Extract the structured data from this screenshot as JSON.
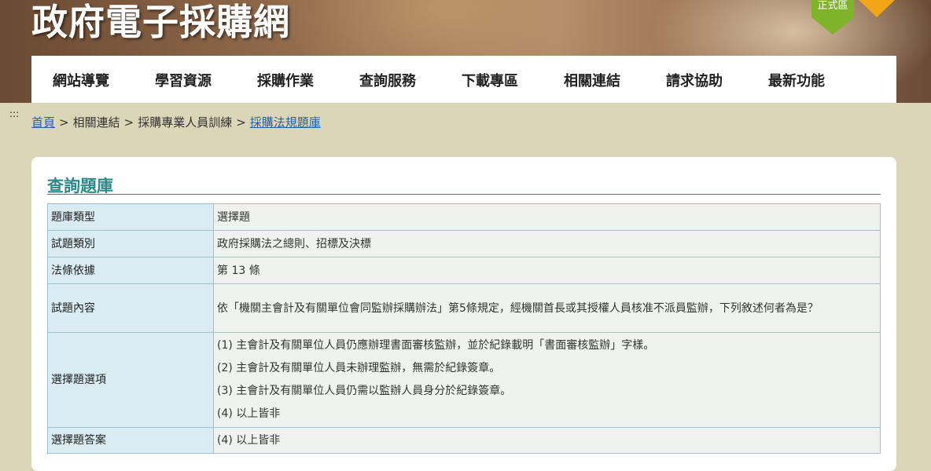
{
  "header": {
    "site_title": "政府電子採購網",
    "zone_badge": "正式區",
    "badge_colors": {
      "primary": "#7fb32a",
      "secondary": "#f2a516"
    }
  },
  "nav": {
    "items": [
      {
        "label": "網站導覽"
      },
      {
        "label": "學習資源"
      },
      {
        "label": "採購作業"
      },
      {
        "label": "查詢服務"
      },
      {
        "label": "下載專區"
      },
      {
        "label": "相關連結"
      },
      {
        "label": "請求協助"
      },
      {
        "label": "最新功能"
      }
    ]
  },
  "accesskey": ":::",
  "breadcrumb": {
    "home": "首頁",
    "separator": ">",
    "level1": "相關連結",
    "level2": "採購專業人員訓練",
    "current": "採購法規題庫"
  },
  "card": {
    "title": "查詢題庫",
    "accent_color": "#2b8a8a"
  },
  "question": {
    "type_label": "題庫類型",
    "type_value": "選擇題",
    "category_label": "試題類別",
    "category_value": "政府採購法之總則、招標及決標",
    "basis_label": "法條依據",
    "basis_value": "第 13 條",
    "content_label": "試題內容",
    "content_value": "依「機關主會計及有關單位會同監辦採購辦法」第5條規定，經機關首長或其授權人員核准不派員監辦，下列敘述何者為是？",
    "options_label": "選擇題選項",
    "options": [
      "(1)  主會計及有關單位人員仍應辦理書面審核監辦，並於紀錄載明「書面審核監辦」字樣。",
      "(2)  主會計及有關單位人員未辦理監辦，無需於紀錄簽章。",
      "(3)  主會計及有關單位人員仍需以監辦人員身分於紀錄簽章。",
      "(4)  以上皆非"
    ],
    "answer_label": "選擇題答案",
    "answer_value": "(4) 以上皆非"
  }
}
